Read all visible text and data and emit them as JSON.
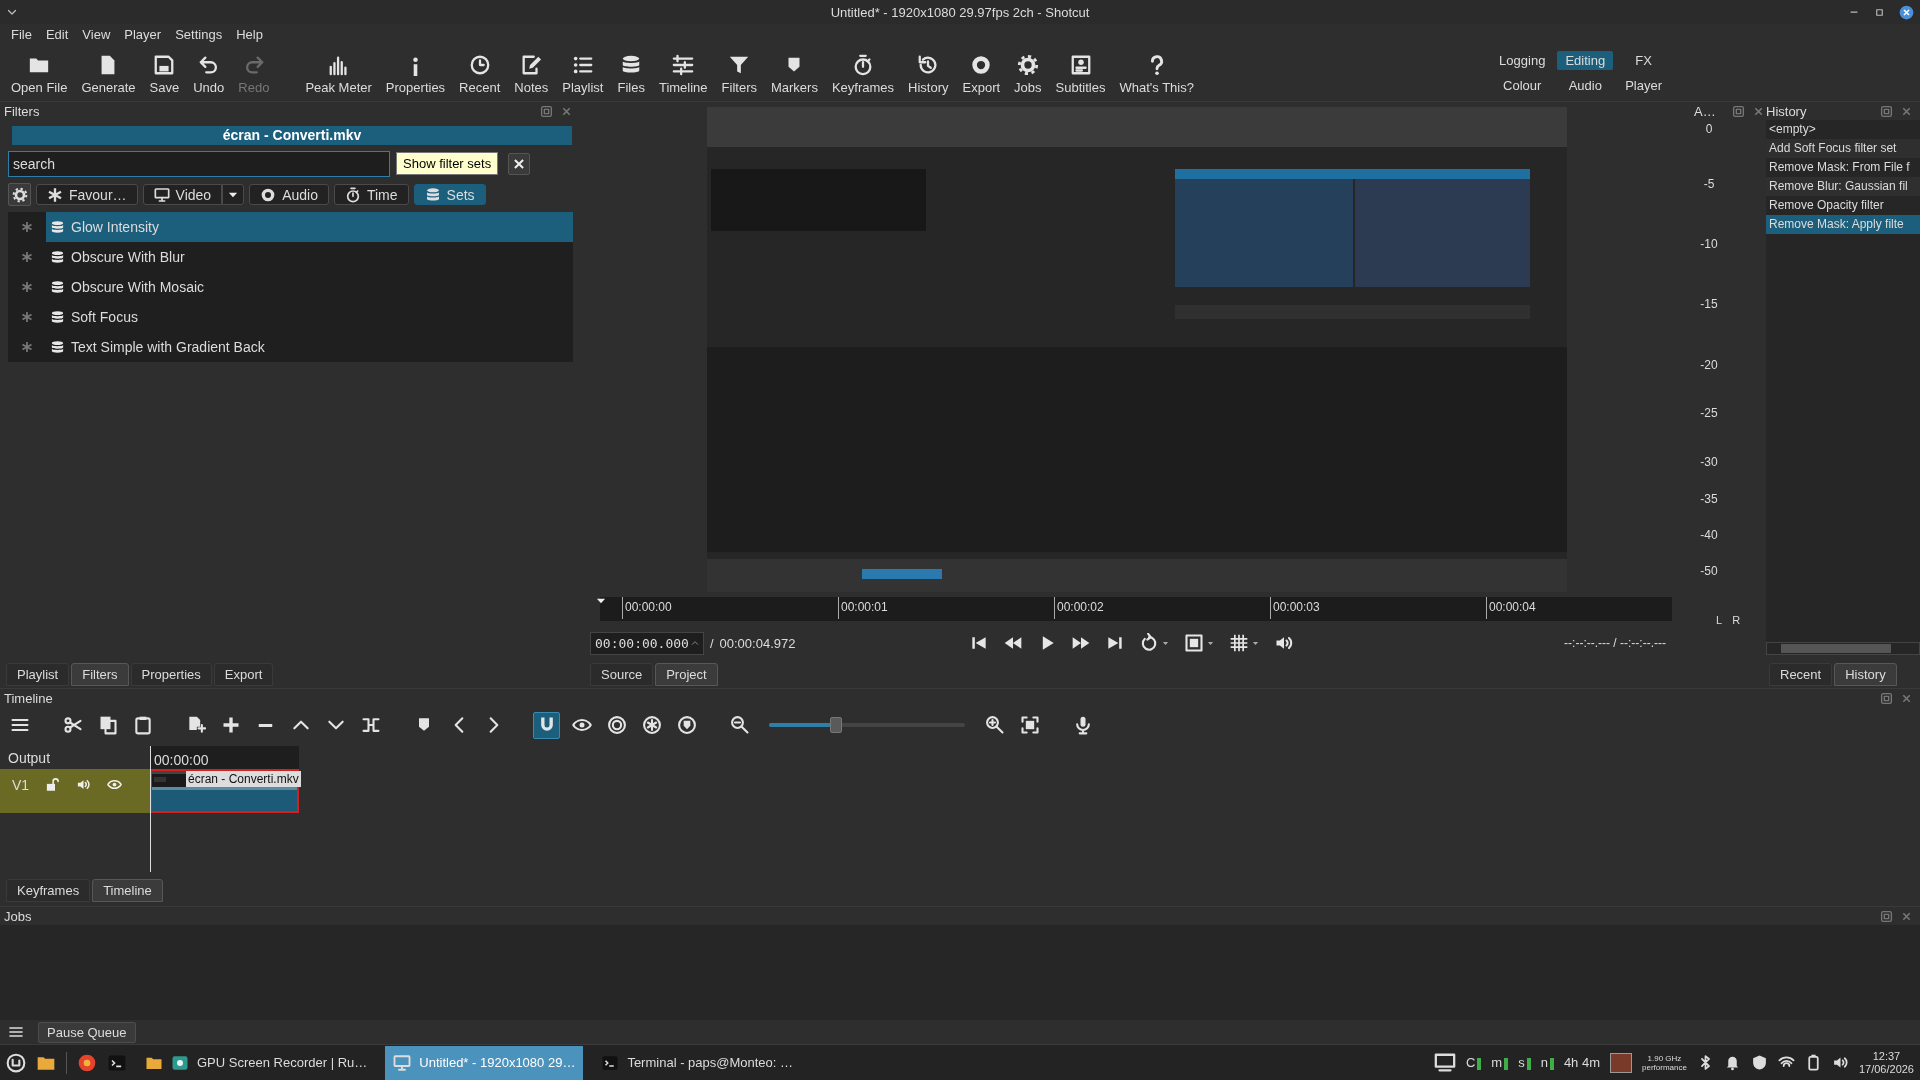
{
  "window": {
    "title": "Untitled* - 1920x1080 29.97fps 2ch - Shotcut"
  },
  "menu": [
    "File",
    "Edit",
    "View",
    "Player",
    "Settings",
    "Help"
  ],
  "toolbar": [
    {
      "label": "Open File",
      "disabled": false
    },
    {
      "label": "Generate",
      "disabled": false
    },
    {
      "label": "Save",
      "disabled": false
    },
    {
      "label": "Undo",
      "disabled": false
    },
    {
      "label": "Redo",
      "disabled": true
    },
    {
      "label": "Peak Meter",
      "disabled": false
    },
    {
      "label": "Properties",
      "disabled": false
    },
    {
      "label": "Recent",
      "disabled": false
    },
    {
      "label": "Notes",
      "disabled": false
    },
    {
      "label": "Playlist",
      "disabled": false
    },
    {
      "label": "Files",
      "disabled": false
    },
    {
      "label": "Timeline",
      "disabled": false
    },
    {
      "label": "Filters",
      "disabled": false
    },
    {
      "label": "Markers",
      "disabled": false
    },
    {
      "label": "Keyframes",
      "disabled": false
    },
    {
      "label": "History",
      "disabled": false
    },
    {
      "label": "Export",
      "disabled": false
    },
    {
      "label": "Jobs",
      "disabled": false
    },
    {
      "label": "Subtitles",
      "disabled": false
    },
    {
      "label": "What's This?",
      "disabled": false
    }
  ],
  "layouts": [
    {
      "label": "Logging",
      "selected": false
    },
    {
      "label": "Editing",
      "selected": true
    },
    {
      "label": "FX",
      "selected": false
    },
    {
      "label": "Colour",
      "selected": false
    },
    {
      "label": "Audio",
      "selected": false
    },
    {
      "label": "Player",
      "selected": false
    }
  ],
  "filters": {
    "title": "Filters",
    "clip": "écran - Converti.mkv",
    "search": {
      "placeholder": "search"
    },
    "tooltip": "Show filter sets",
    "categories": [
      {
        "label": "Favour…",
        "selected": false
      },
      {
        "label": "Video",
        "selected": false
      },
      {
        "label": "Audio",
        "selected": false
      },
      {
        "label": "Time",
        "selected": false
      },
      {
        "label": "Sets",
        "selected": true
      }
    ],
    "items": [
      {
        "label": "Glow Intensity",
        "selected": true
      },
      {
        "label": "Obscure With Blur",
        "selected": false
      },
      {
        "label": "Obscure With Mosaic",
        "selected": false
      },
      {
        "label": "Soft Focus",
        "selected": false
      },
      {
        "label": "Text Simple with Gradient Back",
        "selected": false
      }
    ],
    "tabs": [
      {
        "label": "Playlist",
        "selected": false
      },
      {
        "label": "Filters",
        "selected": true
      },
      {
        "label": "Properties",
        "selected": false
      },
      {
        "label": "Export",
        "selected": false
      }
    ]
  },
  "preview": {
    "kind": "picture",
    "ruler": [
      "00:00:00",
      "00:00:01",
      "00:00:02",
      "00:00:03",
      "00:00:04"
    ],
    "timecode": "00:00:00.000",
    "separator": "/",
    "duration": "00:00:04.972",
    "in_out": "--:--:--.--- / --:--:--.---",
    "tabs": [
      {
        "label": "Source",
        "selected": false
      },
      {
        "label": "Project",
        "selected": true
      }
    ]
  },
  "meter": {
    "title": "A…",
    "scale": [
      "0",
      "-5",
      "-10",
      "-15",
      "-20",
      "-25",
      "-30",
      "-35",
      "-40",
      "-50"
    ],
    "channels": [
      "L",
      "R"
    ]
  },
  "history": {
    "title": "History",
    "items": [
      {
        "label": "<empty>",
        "selected": false
      },
      {
        "label": "Add Soft Focus filter set",
        "selected": false
      },
      {
        "label": "Remove Mask: From File f",
        "selected": false
      },
      {
        "label": "Remove Blur: Gaussian fil",
        "selected": false
      },
      {
        "label": "Remove Opacity filter",
        "selected": false
      },
      {
        "label": "Remove Mask: Apply filte",
        "selected": true
      }
    ],
    "tabs": [
      {
        "label": "Recent",
        "selected": false
      },
      {
        "label": "History",
        "selected": true
      }
    ]
  },
  "timeline": {
    "title": "Timeline",
    "toggles": [
      {
        "on": true
      },
      {
        "on": false
      },
      {
        "on": false
      },
      {
        "on": false
      },
      {
        "on": false
      }
    ],
    "zoom": {
      "level": 0.34
    },
    "output": "Output",
    "time": "00:00:00",
    "tracks": [
      {
        "name": "V1",
        "clips": [
          {
            "name": "écran - Converti.mkv",
            "selected": true
          }
        ]
      }
    ],
    "tabs": [
      {
        "label": "Keyframes",
        "selected": false
      },
      {
        "label": "Timeline",
        "selected": true
      }
    ]
  },
  "jobs": {
    "title": "Jobs",
    "pause": "Pause Queue"
  },
  "taskbar": {
    "windows": [
      {
        "label": "GPU Screen Recorder | Ru…",
        "selected": false
      },
      {
        "label": "Untitled* - 1920x1080 29…",
        "selected": true
      },
      {
        "label": "Terminal - paps@Monteo: …",
        "selected": false
      }
    ],
    "monitors": [
      "C",
      "m",
      "s",
      "n"
    ],
    "battery": "4h 4m",
    "cpu": "1.90 GHz",
    "governor": "performance",
    "time": "12:37",
    "date": "17/06/2026"
  }
}
